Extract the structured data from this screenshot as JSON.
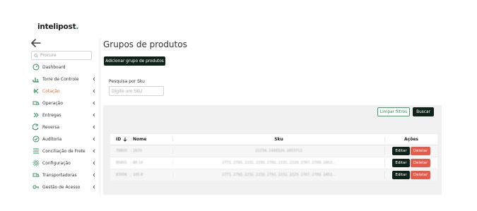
{
  "brand": {
    "name": "intelipost",
    "dot": "."
  },
  "sidebar": {
    "search_placeholder": "Procure",
    "items": [
      {
        "label": "Dashboard",
        "icon": "dashboard-icon",
        "has_chevron": false,
        "active": false
      },
      {
        "label": "Torre de Controle",
        "icon": "chart-bars-icon",
        "has_chevron": true,
        "active": false
      },
      {
        "label": "Cotação",
        "icon": "calculator-icon",
        "has_chevron": true,
        "active": true
      },
      {
        "label": "Operação",
        "icon": "truck-icon",
        "has_chevron": true,
        "active": false
      },
      {
        "label": "Entregas",
        "icon": "chevrons-right-icon",
        "has_chevron": true,
        "active": false
      },
      {
        "label": "Reversa",
        "icon": "return-icon",
        "has_chevron": true,
        "active": false
      },
      {
        "label": "Auditoria",
        "icon": "check-badge-icon",
        "has_chevron": true,
        "active": false
      },
      {
        "label": "Conciliação de Frete",
        "icon": "list-icon",
        "has_chevron": true,
        "active": false
      },
      {
        "label": "Configuração",
        "icon": "gear-icon",
        "has_chevron": true,
        "active": false
      },
      {
        "label": "Transportadoras",
        "icon": "truck-icon",
        "has_chevron": true,
        "active": false
      },
      {
        "label": "Gestão de Acesso",
        "icon": "key-icon",
        "has_chevron": true,
        "active": false
      }
    ]
  },
  "main": {
    "title": "Grupos de produtos",
    "add_button": "Adicionar grupo de produtos",
    "filter": {
      "label": "Pesquisa por Sku",
      "placeholder": "Digite um SKU",
      "clear_button": "Limpar filtros",
      "search_button": "Buscar"
    },
    "table": {
      "headers": {
        "id": "ID",
        "nome": "Nome",
        "sku": "Sku",
        "acoes": "Ações"
      },
      "sort_icon": "arrow-down-icon",
      "rows": [
        {
          "id": "79800",
          "nome": "1870",
          "sku": "21234, 1448324, 2453711"
        },
        {
          "id": "85801",
          "nome": "88 14",
          "sku": "2771, 2793, 2231, 2230, 2791, 2231, 2229, 2767, 2799, 2453..."
        },
        {
          "id": "83006",
          "nome": "185 8",
          "sku": "2771, 2793, 2231, 2230, 2791, 2231, 2229, 2767, 2799, 2453..."
        }
      ],
      "edit_label": "Editar",
      "delete_label": "Deletar"
    }
  },
  "colors": {
    "primary_dark": "#10231a",
    "accent_green": "#2c8f54",
    "active_orange": "#e06a2a",
    "danger": "#e85a4a"
  }
}
